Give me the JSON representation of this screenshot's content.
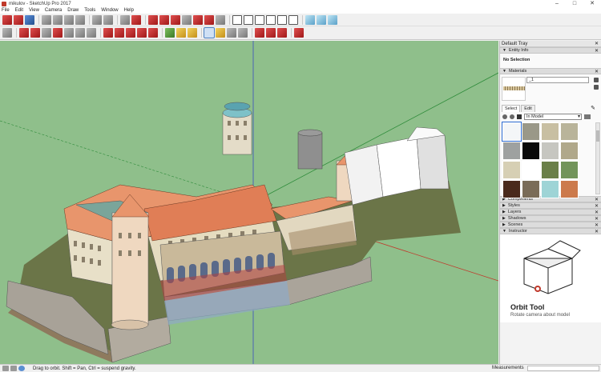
{
  "window": {
    "title": "mikulov - SketchUp Pro 2017",
    "controls": [
      "–",
      "□",
      "✕"
    ]
  },
  "menu": [
    "File",
    "Edit",
    "View",
    "Camera",
    "Draw",
    "Tools",
    "Window",
    "Help"
  ],
  "toolbar_top": [
    {
      "icon": "get-started-icon",
      "tone": "red"
    },
    {
      "icon": "open-icon",
      "tone": "red"
    },
    {
      "icon": "save-icon",
      "tone": "blue"
    },
    {
      "sep": true
    },
    {
      "icon": "cut-icon",
      "tone": "grey"
    },
    {
      "icon": "copy-icon",
      "tone": "grey"
    },
    {
      "icon": "paste-icon",
      "tone": "grey"
    },
    {
      "icon": "erase-icon",
      "tone": "grey"
    },
    {
      "sep": true
    },
    {
      "icon": "undo-icon",
      "tone": "grey"
    },
    {
      "icon": "redo-icon",
      "tone": "grey"
    },
    {
      "sep": true
    },
    {
      "icon": "print-icon",
      "tone": "grey"
    },
    {
      "icon": "model-info-icon",
      "tone": "red"
    },
    {
      "sep": true
    },
    {
      "icon": "xray-icon",
      "tone": "red"
    },
    {
      "icon": "back-edges-icon",
      "tone": "red"
    },
    {
      "icon": "wireframe-icon",
      "tone": "red"
    },
    {
      "icon": "hidden-line-icon",
      "tone": "grey"
    },
    {
      "icon": "shaded-icon",
      "tone": "red"
    },
    {
      "icon": "shaded-textures-icon",
      "tone": "red"
    },
    {
      "icon": "monochrome-icon",
      "tone": "grey"
    },
    {
      "sep": true
    },
    {
      "icon": "iso-view-icon",
      "tone": "house"
    },
    {
      "icon": "top-view-icon",
      "tone": "house"
    },
    {
      "icon": "front-view-icon",
      "tone": "house"
    },
    {
      "icon": "right-view-icon",
      "tone": "house"
    },
    {
      "icon": "back-view-icon",
      "tone": "house"
    },
    {
      "icon": "left-view-icon",
      "tone": "house"
    },
    {
      "sep": true
    },
    {
      "icon": "section-plane-icon",
      "tone": "cyan"
    },
    {
      "icon": "display-section-icon",
      "tone": "cyan"
    },
    {
      "icon": "section-fill-icon",
      "tone": "cyan"
    }
  ],
  "toolbar_tools": [
    {
      "icon": "select-arrow-icon",
      "tone": "grey"
    },
    {
      "sep": true
    },
    {
      "icon": "eraser-icon",
      "tone": "red"
    },
    {
      "icon": "line-pencil-icon",
      "tone": "red"
    },
    {
      "icon": "dropdown-icon",
      "tone": "grey"
    },
    {
      "icon": "arc-icon",
      "tone": "red"
    },
    {
      "icon": "dropdown-icon",
      "tone": "grey"
    },
    {
      "icon": "rectangle-icon",
      "tone": "grey"
    },
    {
      "icon": "dropdown-icon",
      "tone": "grey"
    },
    {
      "sep": true
    },
    {
      "icon": "push-pull-icon",
      "tone": "red"
    },
    {
      "icon": "offset-icon",
      "tone": "red"
    },
    {
      "icon": "move-icon",
      "tone": "red"
    },
    {
      "icon": "rotate-icon",
      "tone": "red"
    },
    {
      "icon": "scale-icon",
      "tone": "red"
    },
    {
      "sep": true
    },
    {
      "icon": "tape-measure-icon",
      "tone": "green"
    },
    {
      "icon": "text-icon",
      "tone": "yellow"
    },
    {
      "icon": "paint-bucket-icon",
      "tone": "yellow"
    },
    {
      "sep": true
    },
    {
      "icon": "orbit-icon",
      "tone": "active"
    },
    {
      "icon": "pan-icon",
      "tone": "yellow"
    },
    {
      "icon": "zoom-icon",
      "tone": "grey"
    },
    {
      "icon": "zoom-extents-icon",
      "tone": "grey"
    },
    {
      "sep": true
    },
    {
      "icon": "3d-warehouse-icon",
      "tone": "red"
    },
    {
      "icon": "share-model-icon",
      "tone": "red"
    },
    {
      "icon": "extension-warehouse-icon",
      "tone": "red"
    },
    {
      "sep": true
    },
    {
      "icon": "layout-icon",
      "tone": "red"
    }
  ],
  "tray": {
    "title": "Default Tray",
    "entity_info": {
      "title": "Entity Info",
      "selection": "No Selection"
    },
    "materials": {
      "title": "Materials",
      "material_name": "_1",
      "tabs": [
        "Select",
        "Edit"
      ],
      "library": "In Model",
      "swatches": [
        "#f4f6f8",
        "#9a9888",
        "#c8bfa2",
        "#b9b49a",
        "#9ea1a0",
        "#0a0a0a",
        "#c6c6c0",
        "#b0a88a",
        "#d6cfb4",
        "#ffffff",
        "#6a7f48",
        "#72945a",
        "#4a2a1c",
        "#7a6c58",
        "#9ed4d6",
        "#cc7a4c"
      ],
      "selected_index": 0
    },
    "panels": [
      "Components",
      "Styles",
      "Layers",
      "Shadows",
      "Scenes"
    ],
    "instructor": {
      "title": "Instructor",
      "tool_name": "Orbit Tool",
      "tool_desc": "Rotate camera about model"
    }
  },
  "status": {
    "hint": "Drag to orbit. Shift = Pan, Ctrl = suspend gravity.",
    "measurements_label": "Measurements",
    "measurements_value": ""
  },
  "colors": {
    "viewport_bg": "#8fbf8b",
    "roof": "#e8956c",
    "wall": "#e8e0c8",
    "stone": "#a8a298",
    "axis_red": "#c0392b",
    "axis_green": "#2e8b3a",
    "axis_blue": "#3a4fbf"
  }
}
